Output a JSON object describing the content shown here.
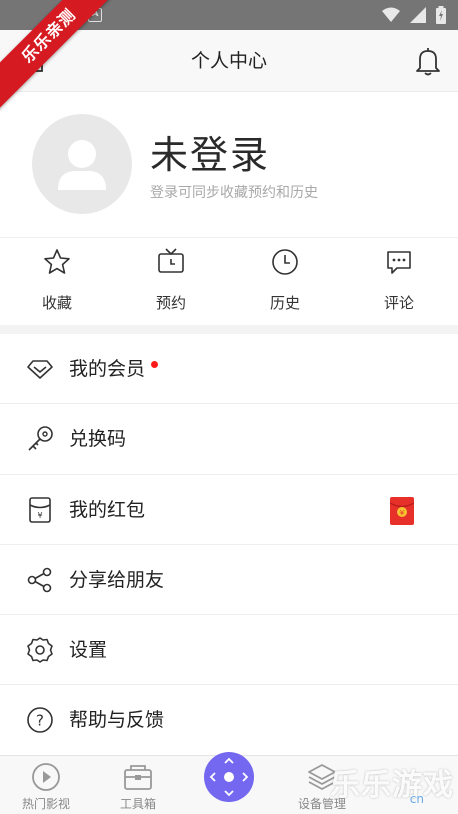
{
  "statusbar": {
    "notification_icon": "a-square-icon",
    "icons": [
      "wifi-icon",
      "signal-icon",
      "battery-icon"
    ]
  },
  "ribbon": {
    "text": "乐乐亲测"
  },
  "header": {
    "title": "个人中心",
    "left_icon": "back-icon",
    "right_icon": "bell-icon"
  },
  "profile": {
    "title": "未登录",
    "subtitle": "登录可同步收藏预约和历史"
  },
  "quick_actions": [
    {
      "label": "收藏",
      "icon": "star-icon"
    },
    {
      "label": "预约",
      "icon": "tv-clock-icon"
    },
    {
      "label": "历史",
      "icon": "clock-icon"
    },
    {
      "label": "评论",
      "icon": "comment-icon"
    }
  ],
  "menu": [
    {
      "label": "我的会员",
      "icon": "diamond-icon",
      "badge": "red-dot"
    },
    {
      "label": "兑换码",
      "icon": "key-icon"
    },
    {
      "label": "我的红包",
      "icon": "yuan-envelope-icon",
      "badge": "red-packet-icon"
    },
    {
      "label": "分享给朋友",
      "icon": "share-icon"
    },
    {
      "label": "设置",
      "icon": "gear-icon"
    },
    {
      "label": "帮助与反馈",
      "icon": "help-icon"
    }
  ],
  "tabbar": {
    "tabs": [
      {
        "label": "热门影视",
        "icon": "play-circle-icon"
      },
      {
        "label": "工具箱",
        "icon": "toolbox-icon"
      },
      {
        "label": "设备管理",
        "icon": "layers-icon"
      }
    ],
    "center_icon": "remote-control-icon"
  },
  "watermark": {
    "text": "乐乐游戏",
    "url": "cn"
  },
  "colors": {
    "accent": "#7468f0",
    "red": "#ff1a1a",
    "ribbon": "#d51a21"
  }
}
